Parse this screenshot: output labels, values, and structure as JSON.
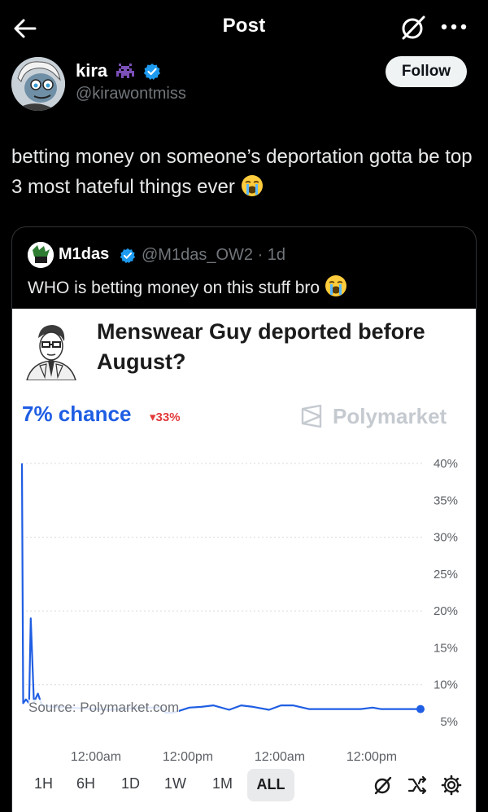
{
  "nav": {
    "title": "Post"
  },
  "author": {
    "name": "kira",
    "handle": "@kirawontmiss"
  },
  "follow": {
    "label": "Follow"
  },
  "post": {
    "text": "betting money on someone’s deportation gotta be top 3 most hateful things ever"
  },
  "quote": {
    "name": "M1das",
    "meta": "@M1das_OW2 · 1d",
    "text": "WHO is betting money on this stuff bro"
  },
  "polymarket": {
    "title": "Menswear Guy deported before August?",
    "chance": "7% chance",
    "change": "▾33%",
    "brand": "Polymarket",
    "source": "Source: Polymarket.com",
    "accent_color": "#1f5ee3",
    "down_color": "#e23a3a",
    "timeframes": [
      "1H",
      "6H",
      "1D",
      "1W",
      "1M",
      "ALL"
    ],
    "active_timeframe": "ALL"
  },
  "chart_data": {
    "type": "line",
    "ytick_labels": [
      "40%",
      "35%",
      "30%",
      "25%",
      "20%",
      "15%",
      "10%",
      "5%"
    ],
    "xtick_labels": [
      "12:00am",
      "12:00pm",
      "12:00am",
      "12:00pm"
    ],
    "ylim": [
      5,
      40
    ],
    "ylabel_unit": "%",
    "x": [
      0,
      0.3,
      1,
      1.8,
      2.2,
      3,
      4,
      5,
      8,
      15,
      22,
      30,
      35,
      36,
      38,
      42,
      45,
      48,
      52,
      55,
      58,
      62,
      65,
      68,
      72,
      78,
      85,
      88,
      90,
      95,
      100
    ],
    "values": [
      40,
      7.5,
      8,
      7.5,
      19,
      7.6,
      8.8,
      7.2,
      7.0,
      6.8,
      6.6,
      6.9,
      6.9,
      6.2,
      6.2,
      6.9,
      7.0,
      7.2,
      6.6,
      7.2,
      7.0,
      6.6,
      7.2,
      7.2,
      6.7,
      6.7,
      6.7,
      6.9,
      6.7,
      6.7,
      6.7
    ],
    "series": [
      {
        "name": "",
        "color": "#1f5ee3"
      }
    ],
    "grid": true
  }
}
